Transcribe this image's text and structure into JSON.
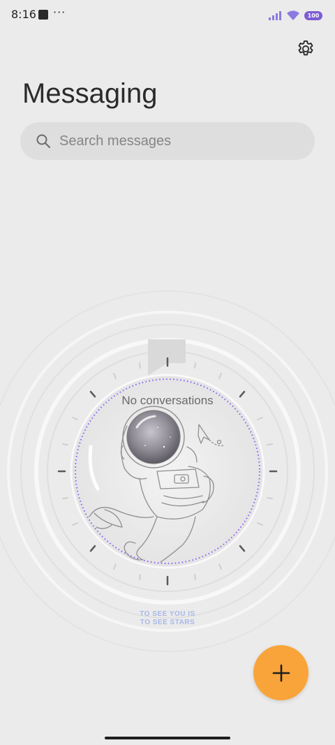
{
  "status_bar": {
    "time": "8:16",
    "more": "···",
    "battery": "100"
  },
  "header": {
    "title": "Messaging",
    "settings_icon": "gear-icon"
  },
  "search": {
    "placeholder": "Search messages",
    "icon": "search-icon"
  },
  "empty_state": {
    "message": "No conversations",
    "tagline_line1": "TO SEE YOU IS",
    "tagline_line2": "TO SEE STARS"
  },
  "fab": {
    "icon": "plus-icon",
    "color": "#f9a43a"
  },
  "colors": {
    "background": "#ebebeb",
    "accent_purple": "#7c5cd4",
    "fab_orange": "#f9a43a"
  }
}
